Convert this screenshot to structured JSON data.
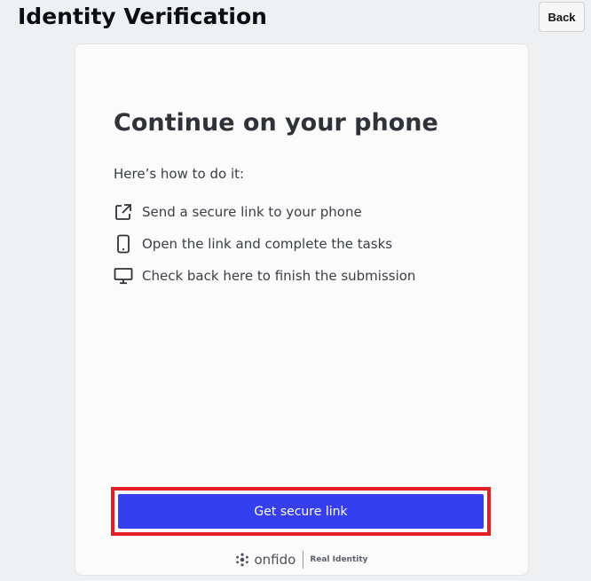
{
  "header": {
    "title": "Identity Verification",
    "back_label": "Back"
  },
  "card": {
    "heading": "Continue on your phone",
    "intro": "Here’s how to do it:",
    "steps": [
      {
        "icon": "external-link-icon",
        "label": "Send a secure link to your phone"
      },
      {
        "icon": "mobile-phone-icon",
        "label": "Open the link and complete the tasks"
      },
      {
        "icon": "desktop-monitor-icon",
        "label": "Check back here to finish the submission"
      }
    ],
    "cta_label": "Get secure link"
  },
  "footer": {
    "brand": "onfido",
    "tagline": "Real Identity"
  },
  "colors": {
    "accent": "#353ff0",
    "highlight": "#e51e25"
  }
}
